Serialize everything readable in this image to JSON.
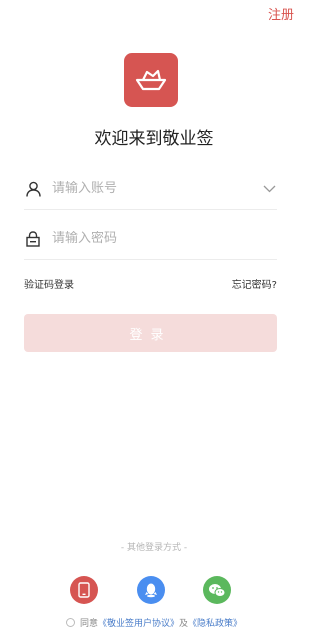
{
  "header": {
    "register_label": "注册"
  },
  "welcome": {
    "title": "欢迎来到敬业签"
  },
  "form": {
    "account_placeholder": "请输入账号",
    "password_placeholder": "请输入密码",
    "sms_login_label": "验证码登录",
    "forgot_password_label": "忘记密码?",
    "login_label": "登录"
  },
  "other_login": {
    "title": "- 其他登录方式 -",
    "options": [
      {
        "icon": "phone-icon"
      },
      {
        "icon": "qq-icon"
      },
      {
        "icon": "wechat-icon"
      }
    ]
  },
  "agreement": {
    "prefix": "同意",
    "user_agreement": "《敬业签用户协议》",
    "conjunction": "及",
    "privacy_policy": "《隐私政策》"
  },
  "colors": {
    "accent": "#d65552",
    "login_disabled_bg": "#f5dcdb",
    "qq_blue": "#4a8ef0",
    "wechat_green": "#5bb85d",
    "link_blue": "#4a7dc9"
  }
}
